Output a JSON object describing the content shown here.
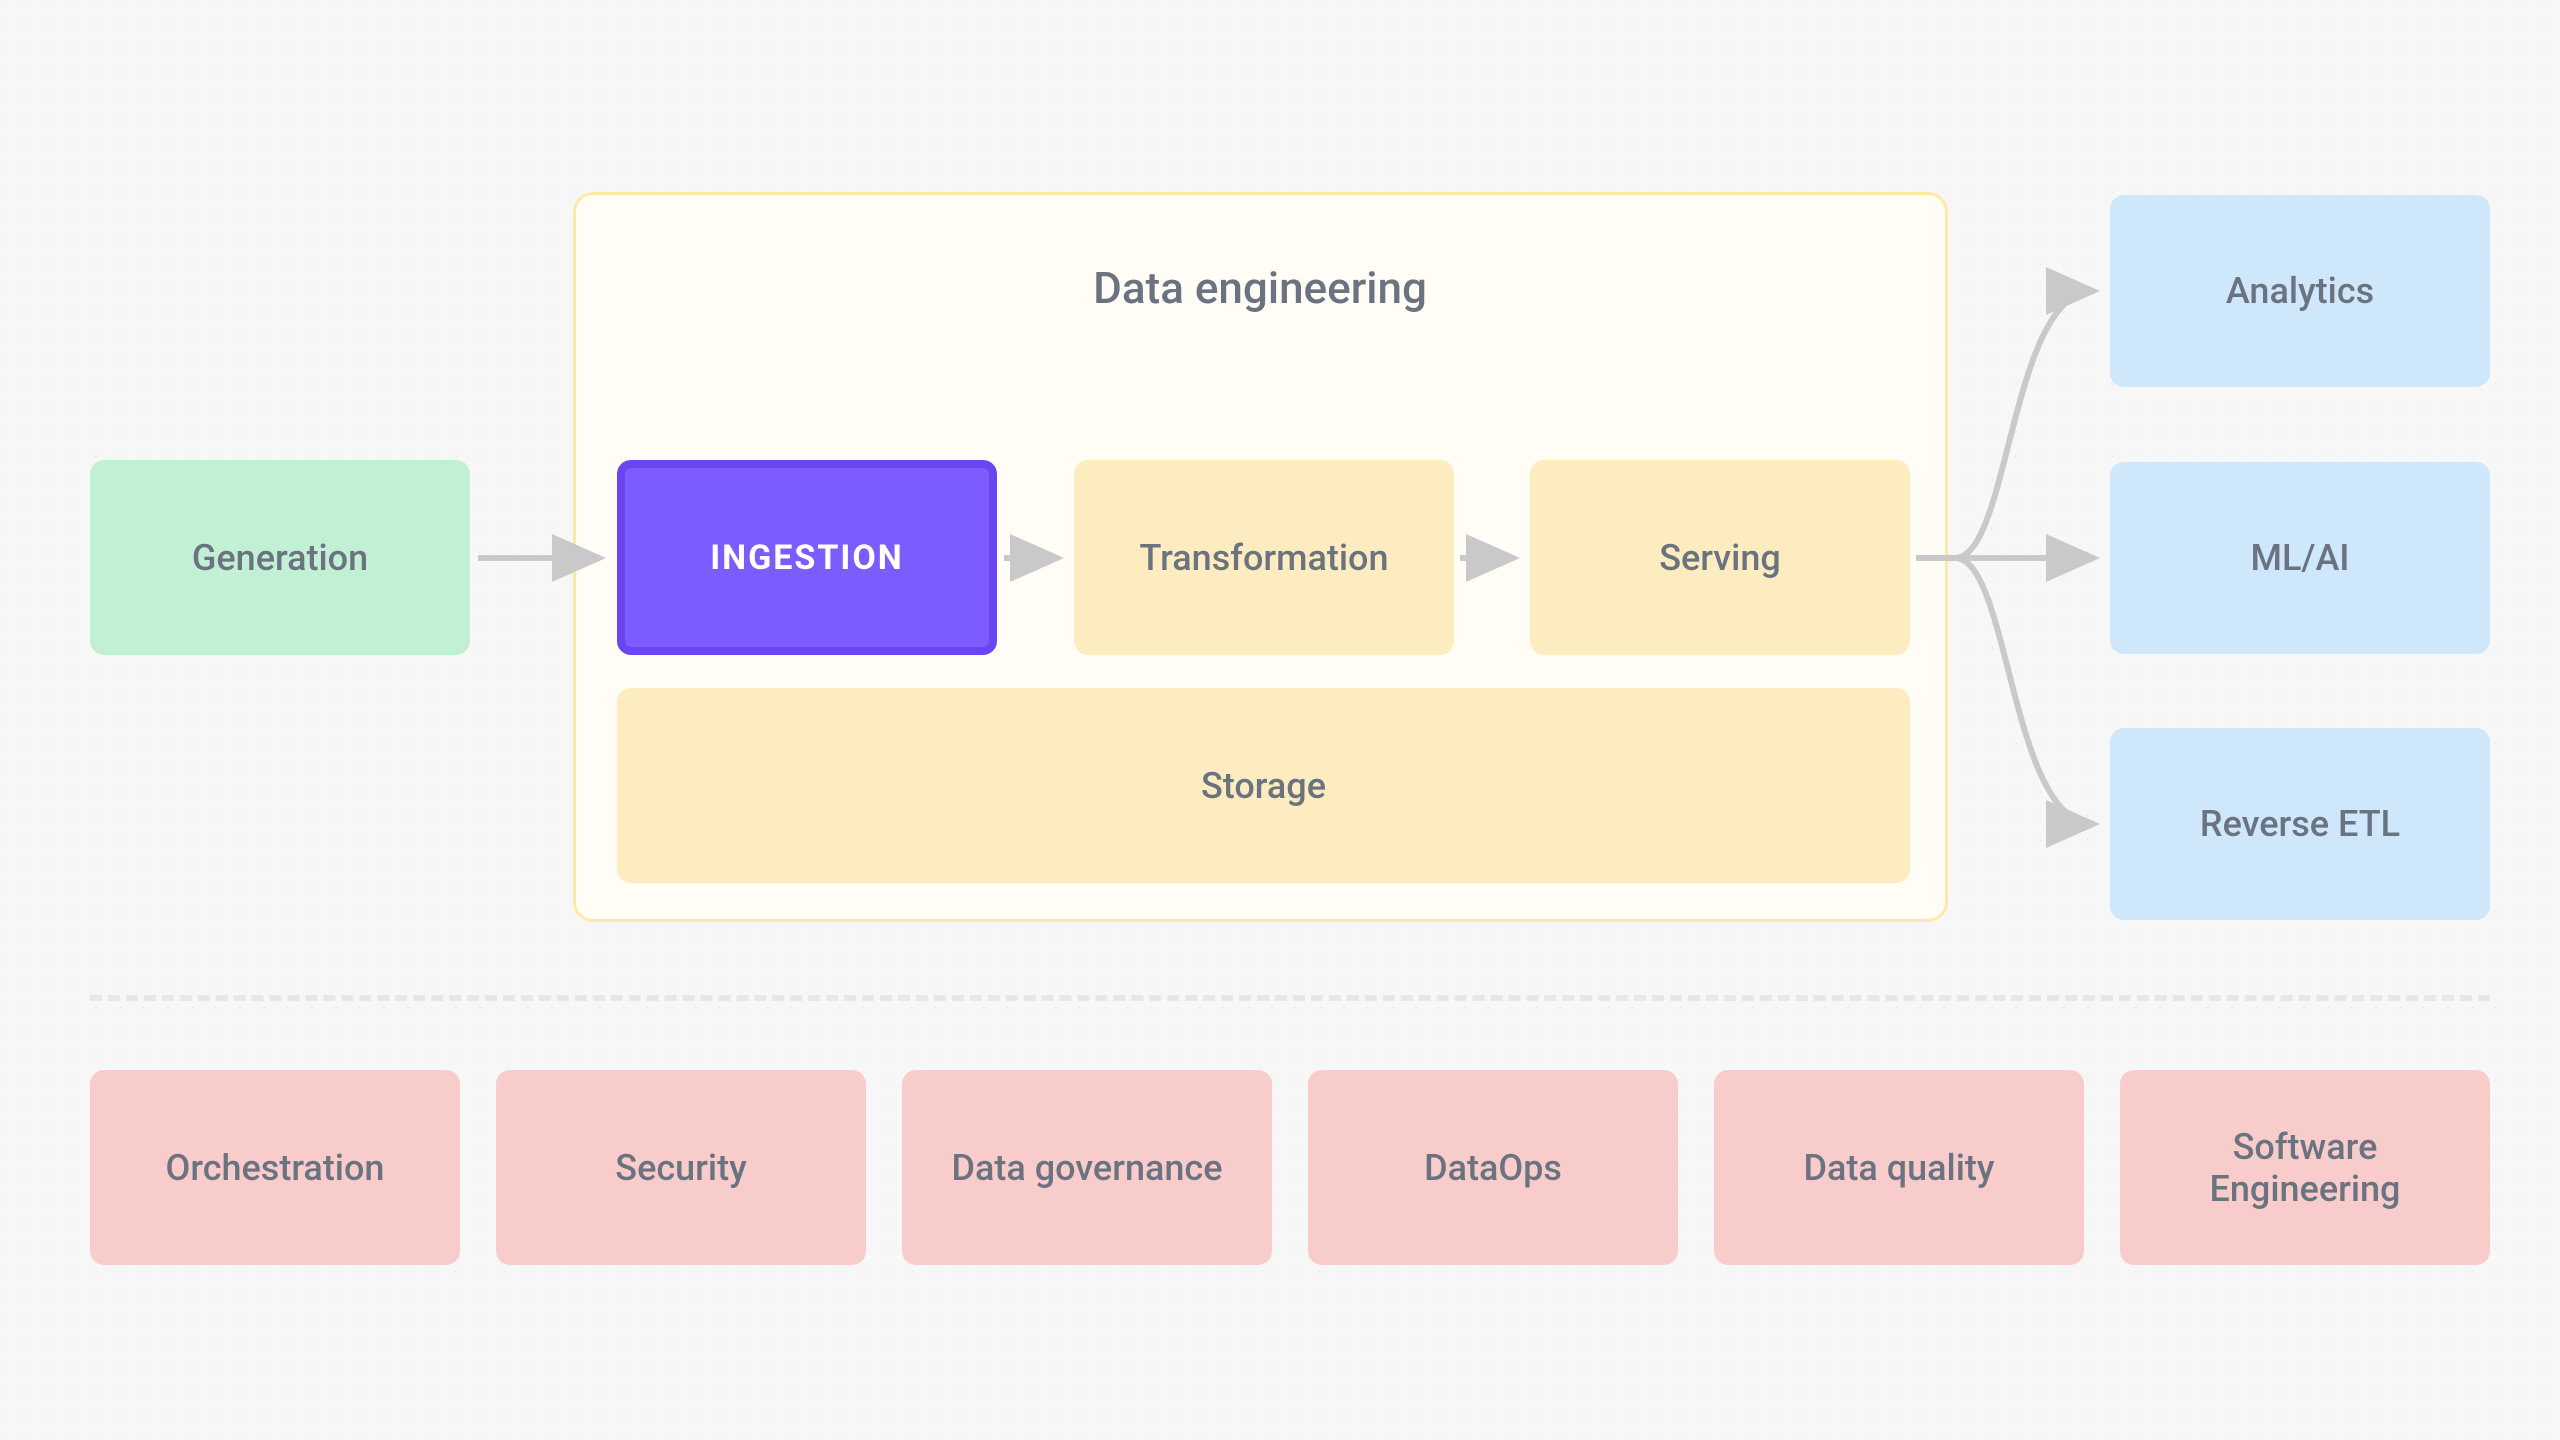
{
  "container": {
    "title": "Data engineering"
  },
  "nodes": {
    "generation": "Generation",
    "ingestion": "INGESTION",
    "transformation": "Transformation",
    "serving": "Serving",
    "storage": "Storage"
  },
  "outputs": {
    "analytics": "Analytics",
    "mlai": "ML/AI",
    "reverse_etl": "Reverse ETL"
  },
  "foundations": {
    "orchestration": "Orchestration",
    "security": "Security",
    "governance": "Data governance",
    "dataops": "DataOps",
    "quality": "Data quality",
    "swe": "Software Engineering"
  }
}
